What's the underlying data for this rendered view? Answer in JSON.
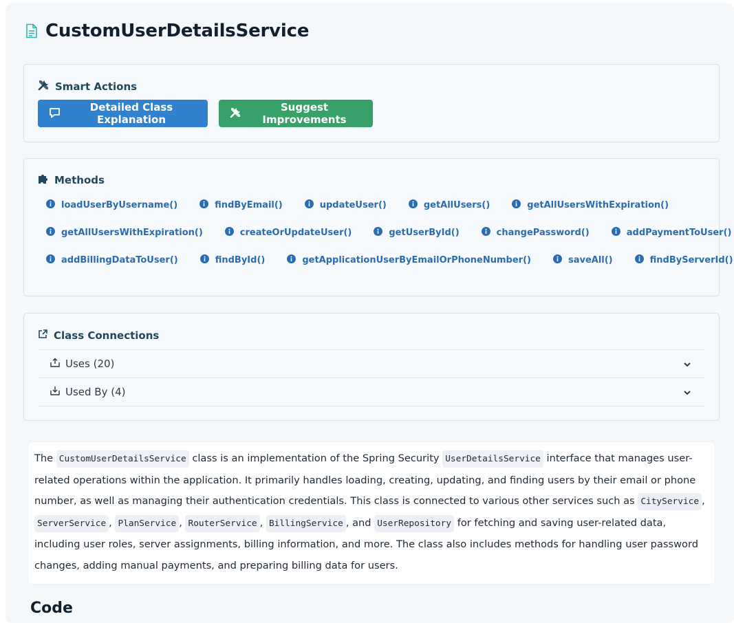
{
  "page": {
    "title": "CustomUserDetailsService"
  },
  "smart_actions": {
    "heading": "Smart Actions",
    "explain_label": "Detailed Class Explanation",
    "improve_label": "Suggest Improvements"
  },
  "methods": {
    "heading": "Methods",
    "rows": [
      [
        "loadUserByUsername()",
        "findByEmail()",
        "updateUser()",
        "getAllUsers()",
        "getAllUsersWithExpiration()"
      ],
      [
        "getAllUsersWithExpiration()",
        "createOrUpdateUser()",
        "getUserById()",
        "changePassword()",
        "addPaymentToUser()"
      ],
      [
        "addBillingDataToUser()",
        "findById()",
        "getApplicationUserByEmailOrPhoneNumber()",
        "saveAll()",
        "findByServerId()"
      ]
    ]
  },
  "connections": {
    "heading": "Class Connections",
    "uses_label": "Uses (20)",
    "used_by_label": "Used By (4)"
  },
  "description": {
    "p1": "The ",
    "c1": "CustomUserDetailsService",
    "p2": " class is an implementation of the Spring Security ",
    "c2": "UserDetailsService",
    "p3": " interface that manages user-related operations within the application. It primarily handles loading, creating, updating, and finding users by their email or phone number, as well as managing their authentication credentials. This class is connected to various other services such as ",
    "c3": "CityService",
    "p4": ", ",
    "c4": "ServerService",
    "p5": ", ",
    "c5": "PlanService",
    "p6": ", ",
    "c6": "RouterService",
    "p7": ", ",
    "c7": "BillingService",
    "p8": ", and ",
    "c8": "UserRepository",
    "p9": " for fetching and saving user-related data, including user roles, server assignments, billing information, and more. The class also includes methods for handling user password changes, adding manual payments, and preparing billing data for users."
  },
  "bottom": {
    "heading": "Code"
  },
  "colors": {
    "primary_blue": "#3182ce",
    "success_green": "#38a169",
    "method_link": "#2b6cb0",
    "heading_teal": "#24465a"
  },
  "icons": {
    "title": "file-text-icon",
    "smart_actions": "tools-icon",
    "explain": "comment-icon",
    "improve": "tools-icon",
    "methods": "puzzle-icon",
    "method_item": "info-circle-icon",
    "connections": "external-link-icon",
    "uses": "upload-icon",
    "used_by": "download-icon",
    "expand": "chevron-down-icon"
  }
}
